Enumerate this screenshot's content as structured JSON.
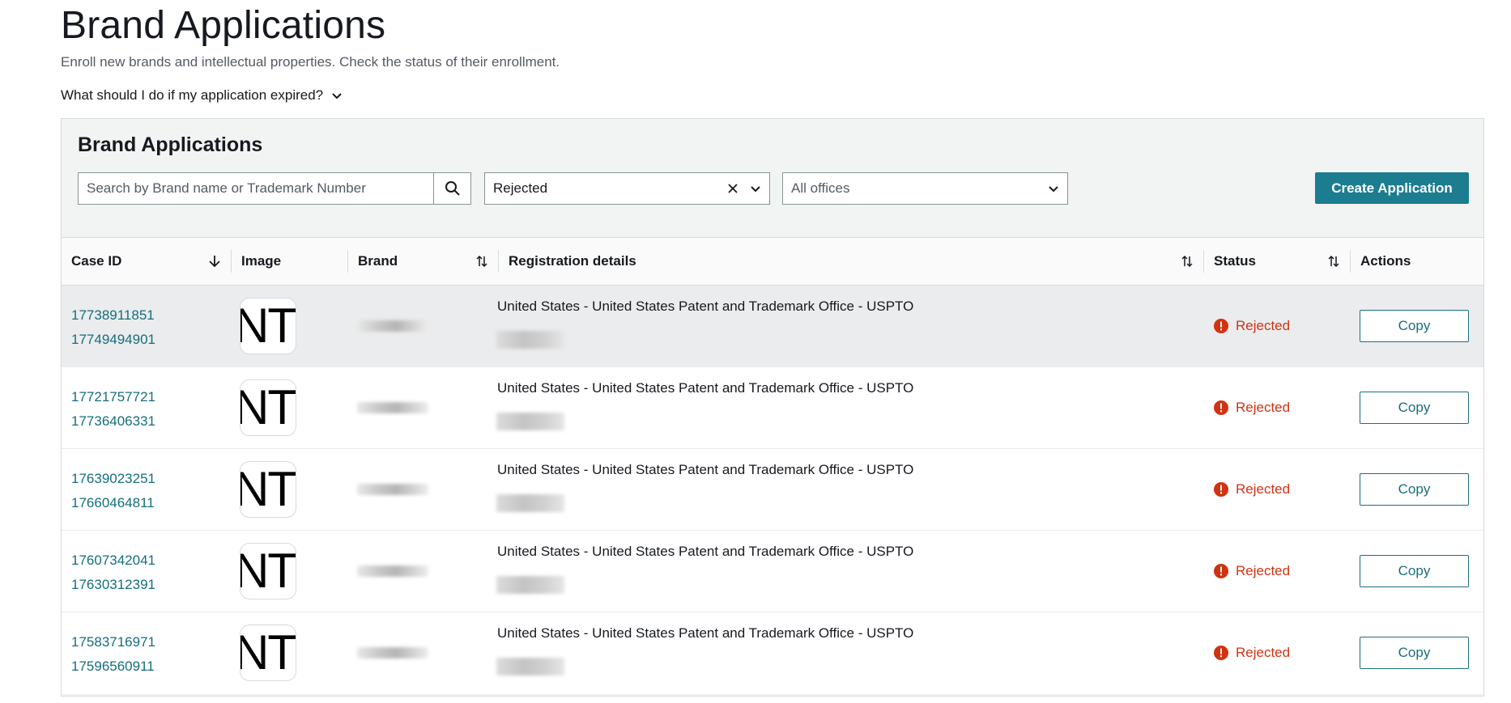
{
  "page": {
    "title": "Brand Applications",
    "subtitle": "Enroll new brands and intellectual properties. Check the status of their enrollment.",
    "faq_label": "What should I do if my application expired?"
  },
  "panel": {
    "title": "Brand Applications",
    "search_placeholder": "Search by Brand name or Trademark Number",
    "status_filter_value": "Rejected",
    "office_filter_value": "All offices",
    "create_button_label": "Create Application"
  },
  "table": {
    "headers": {
      "case_id": "Case ID",
      "image": "Image",
      "brand": "Brand",
      "registration": "Registration details",
      "status": "Status",
      "actions": "Actions"
    },
    "rows": [
      {
        "case_ids": [
          "17738911851",
          "17749494901"
        ],
        "image_text": "NTC",
        "registration": "United States - United States Patent and Trademark Office - USPTO",
        "status": "Rejected",
        "action": "Copy"
      },
      {
        "case_ids": [
          "17721757721",
          "17736406331"
        ],
        "image_text": "NTC",
        "registration": "United States - United States Patent and Trademark Office - USPTO",
        "status": "Rejected",
        "action": "Copy"
      },
      {
        "case_ids": [
          "17639023251",
          "17660464811"
        ],
        "image_text": "NTC",
        "registration": "United States - United States Patent and Trademark Office - USPTO",
        "status": "Rejected",
        "action": "Copy"
      },
      {
        "case_ids": [
          "17607342041",
          "17630312391"
        ],
        "image_text": "NTC",
        "registration": "United States - United States Patent and Trademark Office - USPTO",
        "status": "Rejected",
        "action": "Copy"
      },
      {
        "case_ids": [
          "17583716971",
          "17596560911"
        ],
        "image_text": "NTC",
        "registration": "United States - United States Patent and Trademark Office - USPTO",
        "status": "Rejected",
        "action": "Copy"
      }
    ]
  },
  "colors": {
    "accent": "#1b7d8f",
    "link": "#146e7e",
    "error": "#d13212",
    "panel_bg": "#f2f3f3"
  },
  "icons": {
    "faq": "chevron-down-icon",
    "search": "search-icon",
    "clear": "close-icon",
    "dropdown": "chevron-down-icon",
    "sort_desc": "arrow-down-icon",
    "sort": "sort-icon",
    "status": "error-icon"
  }
}
